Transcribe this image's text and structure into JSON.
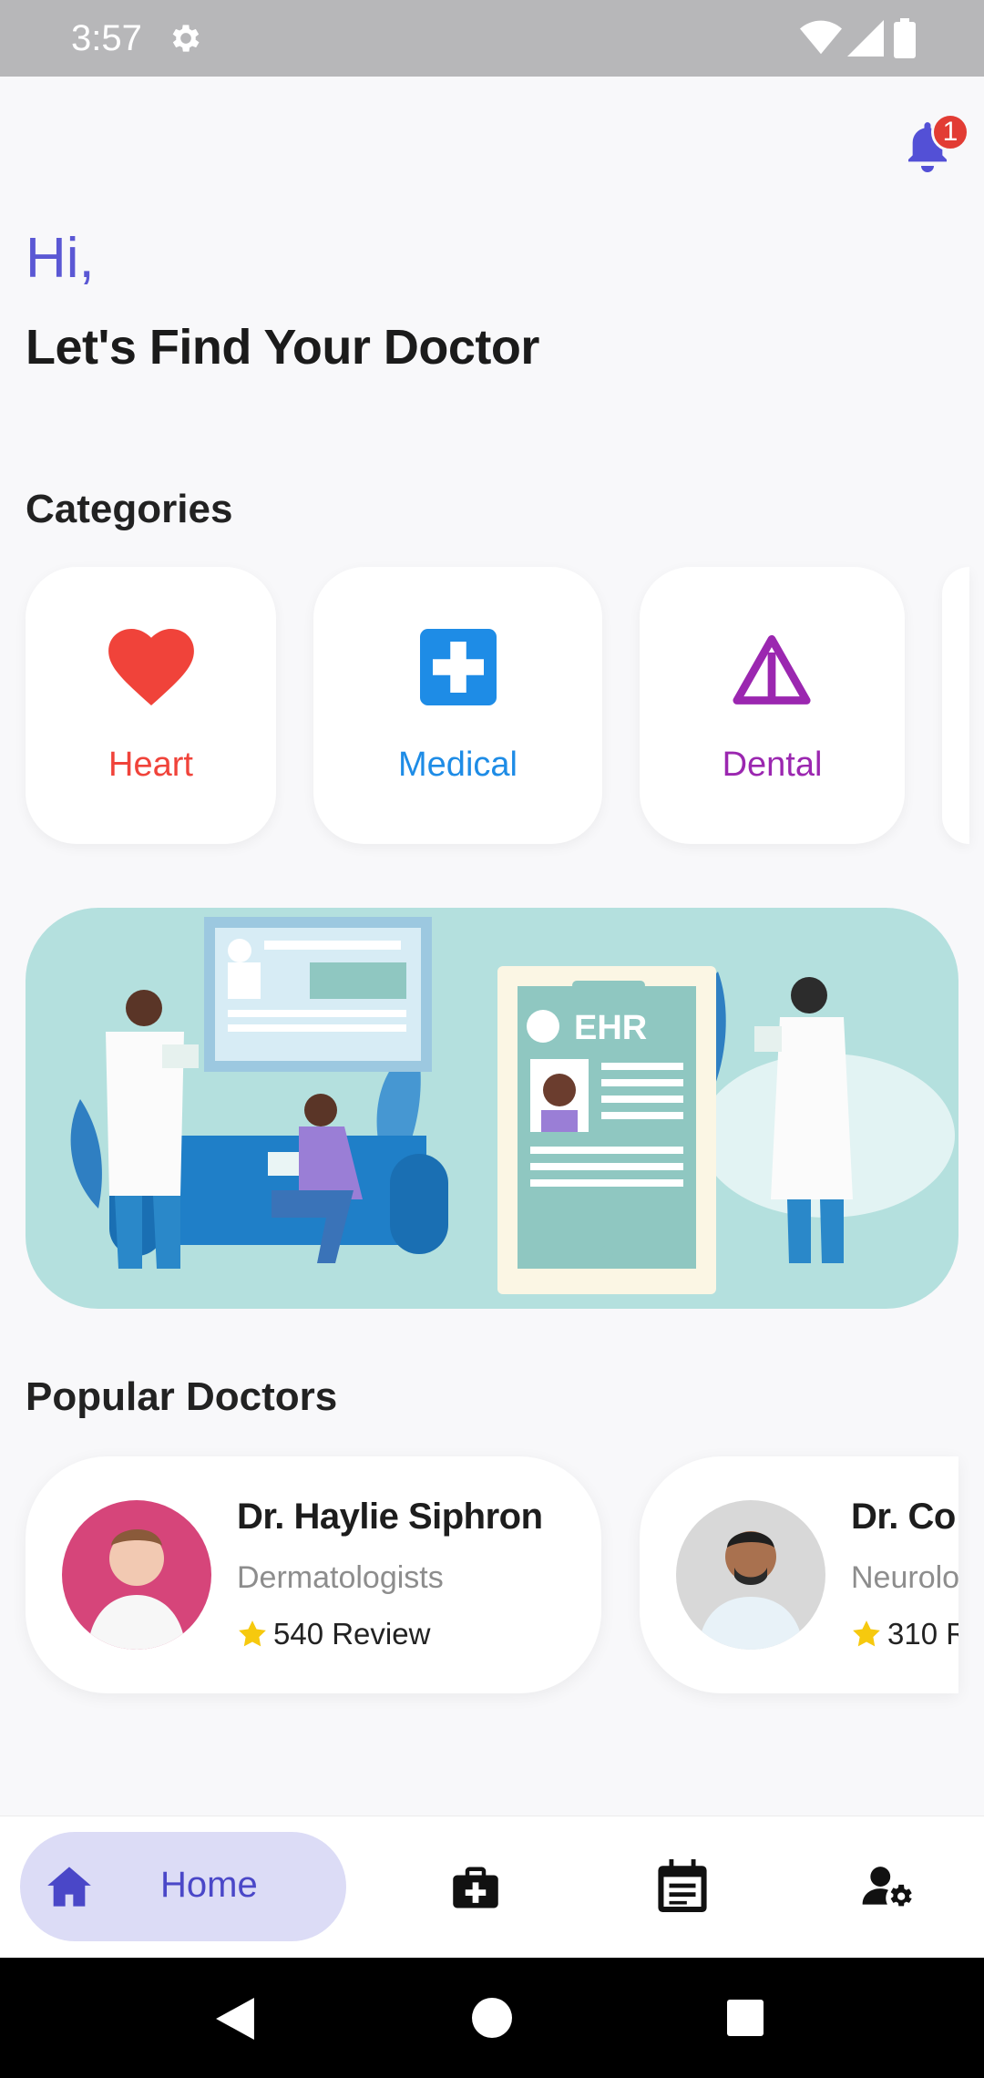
{
  "status_bar": {
    "time": "3:57"
  },
  "notifications": {
    "badge_count": "1"
  },
  "greeting": "Hi,",
  "headline": "Let's Find Your Doctor",
  "categories": {
    "title": "Categories",
    "items": [
      {
        "label": "Heart",
        "color": "#f0433a",
        "icon": "heart-icon"
      },
      {
        "label": "Medical",
        "color": "#1e8ce6",
        "icon": "medical-cross-icon"
      },
      {
        "label": "Dental",
        "color": "#9b27b0",
        "icon": "triangle-warning-icon"
      }
    ]
  },
  "banner": {
    "ehr_text": "EHR"
  },
  "popular_doctors": {
    "title": "Popular Doctors",
    "items": [
      {
        "name": "Dr. Haylie Siphron",
        "specialty": "Dermatologists",
        "reviews": "540 Review"
      },
      {
        "name": "Dr. Co",
        "specialty": "Neurolo",
        "reviews": "310 R"
      }
    ]
  },
  "bottom_nav": {
    "home_label": "Home",
    "accent": "#4a47c8",
    "items": [
      "home-icon",
      "medical-bag-icon",
      "calendar-icon",
      "user-settings-icon"
    ]
  }
}
